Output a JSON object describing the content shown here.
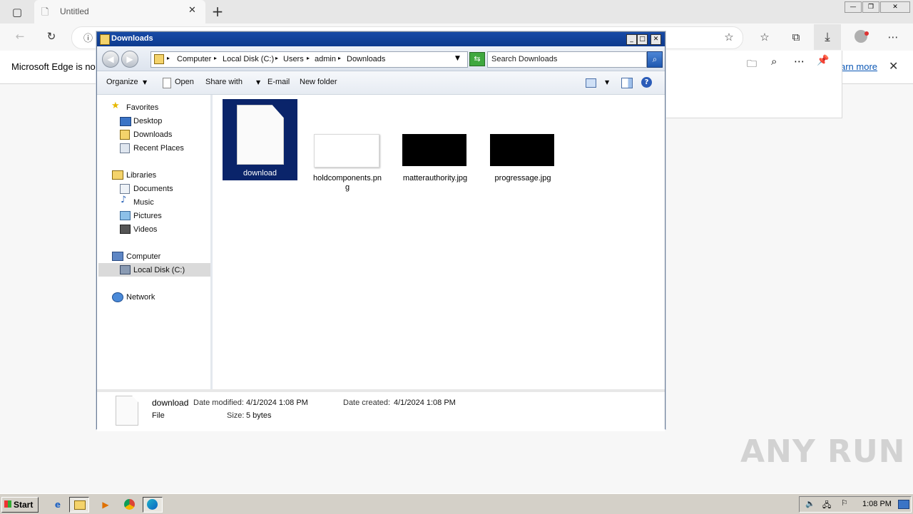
{
  "browser": {
    "tab_title": "Untitled",
    "infobar_text": "Microsoft Edge is no",
    "infobar_link": "arn more"
  },
  "explorer": {
    "title": "Downloads",
    "breadcrumb": [
      "Computer",
      "Local Disk (C:)",
      "Users",
      "admin",
      "Downloads"
    ],
    "search_placeholder": "Search Downloads",
    "commands": {
      "organize": "Organize",
      "open": "Open",
      "share_with": "Share with",
      "email": "E-mail",
      "new_folder": "New folder"
    },
    "nav": {
      "favorites": "Favorites",
      "favorites_items": [
        "Desktop",
        "Downloads",
        "Recent Places"
      ],
      "libraries": "Libraries",
      "libraries_items": [
        "Documents",
        "Music",
        "Pictures",
        "Videos"
      ],
      "computer": "Computer",
      "computer_items": [
        "Local Disk (C:)"
      ],
      "network": "Network"
    },
    "files": [
      {
        "name": "download",
        "kind": "blank-doc",
        "selected": true
      },
      {
        "name": "holdcomponents.png",
        "kind": "white-thumb",
        "selected": false
      },
      {
        "name": "matterauthority.jpg",
        "kind": "black-thumb",
        "selected": false
      },
      {
        "name": "progressage.jpg",
        "kind": "black-thumb",
        "selected": false
      }
    ],
    "details": {
      "name": "download",
      "modified_label": "Date modified:",
      "modified_value": "4/1/2024 1:08 PM",
      "created_label": "Date created:",
      "created_value": "4/1/2024 1:08 PM",
      "type": "File",
      "size_label": "Size:",
      "size_value": "5 bytes"
    }
  },
  "taskbar": {
    "start_label": "Start",
    "clock": "1:08 PM"
  },
  "watermark": "ANY RUN",
  "colors": {
    "title_bar": "#174aa6",
    "selection": "#0a246a",
    "taskbar": "#d4d0c8"
  }
}
